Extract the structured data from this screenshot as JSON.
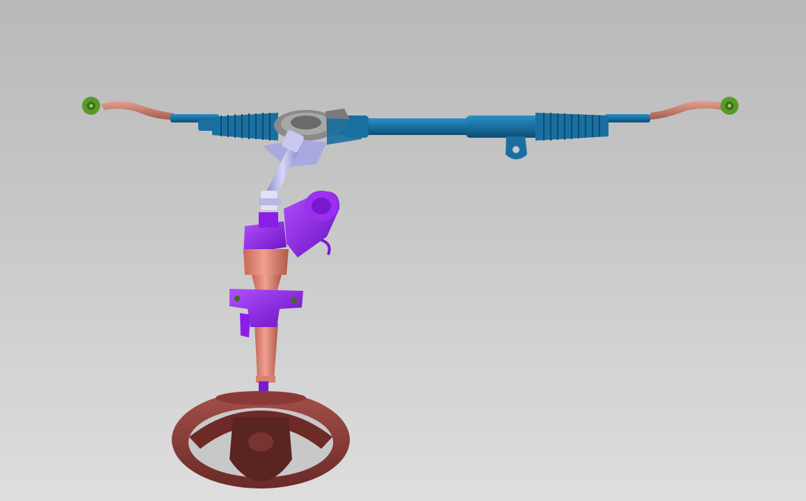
{
  "scene": {
    "description_free": true,
    "colors": {
      "background_top": "#b9b9b9",
      "background_bottom": "#dedede",
      "rack_housing": "#1a6fa0",
      "tie_rod": "#c77a6a",
      "tie_rod_end": "#5a9a2a",
      "intermediate_shaft": "#a9a9e0",
      "pinion_housing": "#7c7c7c",
      "column_motor": "#8a1ee8",
      "column_tube": "#e08070",
      "steering_wheel": "#8a3a36"
    },
    "parts": [
      {
        "name": "rack-housing"
      },
      {
        "name": "left-tie-rod"
      },
      {
        "name": "right-tie-rod"
      },
      {
        "name": "left-tie-rod-end"
      },
      {
        "name": "right-tie-rod-end"
      },
      {
        "name": "left-boot"
      },
      {
        "name": "right-boot"
      },
      {
        "name": "pinion-valve"
      },
      {
        "name": "intermediate-shaft"
      },
      {
        "name": "eps-motor"
      },
      {
        "name": "steering-column"
      },
      {
        "name": "column-bracket"
      },
      {
        "name": "steering-wheel"
      }
    ]
  }
}
